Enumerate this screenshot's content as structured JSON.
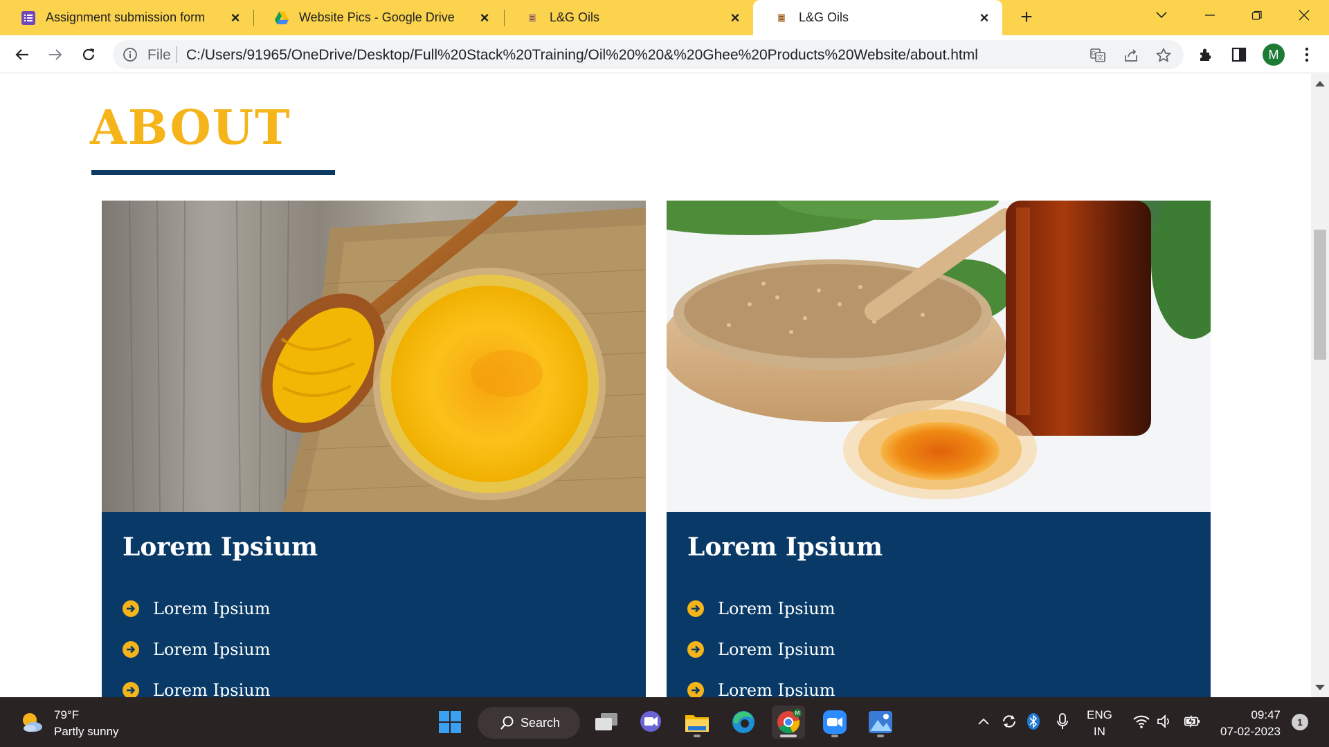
{
  "browser": {
    "tabs": [
      {
        "title": "Assignment submission form",
        "favicon": "forms-icon",
        "active": false
      },
      {
        "title": "Website Pics - Google Drive",
        "favicon": "google-drive-icon",
        "active": false
      },
      {
        "title": "L&G Oils",
        "favicon": "site-icon",
        "active": false
      },
      {
        "title": "L&G Oils",
        "favicon": "site-icon",
        "active": true
      }
    ],
    "address": {
      "scheme_label": "File",
      "url": "C:/Users/91965/OneDrive/Desktop/Full%20Stack%20Training/Oil%20%20&%20Ghee%20Products%20Website/about.html"
    },
    "profile_initial": "M"
  },
  "page": {
    "heading": "ABOUT",
    "cards": [
      {
        "image": "ghee-in-bowl-with-wooden-spoon",
        "title": "Lorem Ipsium",
        "items": [
          "Lorem Ipsium",
          "Lorem Ipsium",
          "Lorem Ipsium"
        ]
      },
      {
        "image": "sesame-seeds-and-sesame-oil",
        "title": "Lorem Ipsium",
        "items": [
          "Lorem Ipsium",
          "Lorem Ipsium",
          "Lorem Ipsium"
        ]
      }
    ]
  },
  "taskbar": {
    "weather": {
      "temp": "79°F",
      "condition": "Partly sunny"
    },
    "search_label": "Search",
    "language": {
      "line1": "ENG",
      "line2": "IN"
    },
    "clock": {
      "time": "09:47",
      "date": "07-02-2023"
    },
    "notification_count": "1"
  },
  "colors": {
    "tabstrip": "#fbd34d",
    "accent_gold": "#f4b41a",
    "navy": "#093a67",
    "taskbar": "#2a2324"
  }
}
